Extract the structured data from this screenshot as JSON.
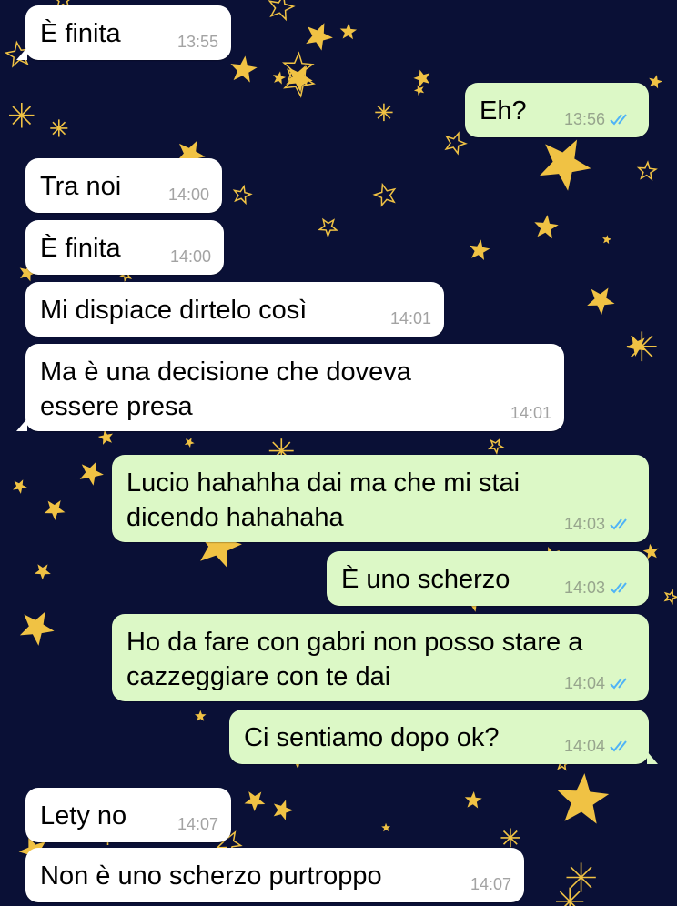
{
  "theme": {
    "background": "#0a1036",
    "incoming_bubble": "#ffffff",
    "outgoing_bubble": "#dcf8c6",
    "star_color": "#f0c244",
    "read_tick_color": "#4fb3f6"
  },
  "messages": [
    {
      "direction": "in",
      "text": "È finita",
      "time": "13:55"
    },
    {
      "direction": "out",
      "text": "Eh?",
      "time": "13:56",
      "status": "read"
    },
    {
      "direction": "in",
      "text": "Tra noi",
      "time": "14:00"
    },
    {
      "direction": "in",
      "text": "È finita",
      "time": "14:00"
    },
    {
      "direction": "in",
      "text": "Mi dispiace dirtelo così",
      "time": "14:01"
    },
    {
      "direction": "in",
      "text": "Ma è una decisione che doveva\nessere presa",
      "time": "14:01"
    },
    {
      "direction": "out",
      "text": "Lucio hahahha dai ma che mi stai\ndicendo hahahaha",
      "time": "14:03",
      "status": "read"
    },
    {
      "direction": "out",
      "text": "È uno scherzo",
      "time": "14:03",
      "status": "read"
    },
    {
      "direction": "out",
      "text": "Ho da fare con gabri non posso stare a\ncazzeggiare con te dai",
      "time": "14:04",
      "status": "read"
    },
    {
      "direction": "out",
      "text": "Ci sentiamo dopo ok?",
      "time": "14:04",
      "status": "read"
    },
    {
      "direction": "in",
      "text": "Lety no",
      "time": "14:07"
    },
    {
      "direction": "in",
      "text": "Non è uno scherzo purtroppo",
      "time": "14:07"
    }
  ]
}
